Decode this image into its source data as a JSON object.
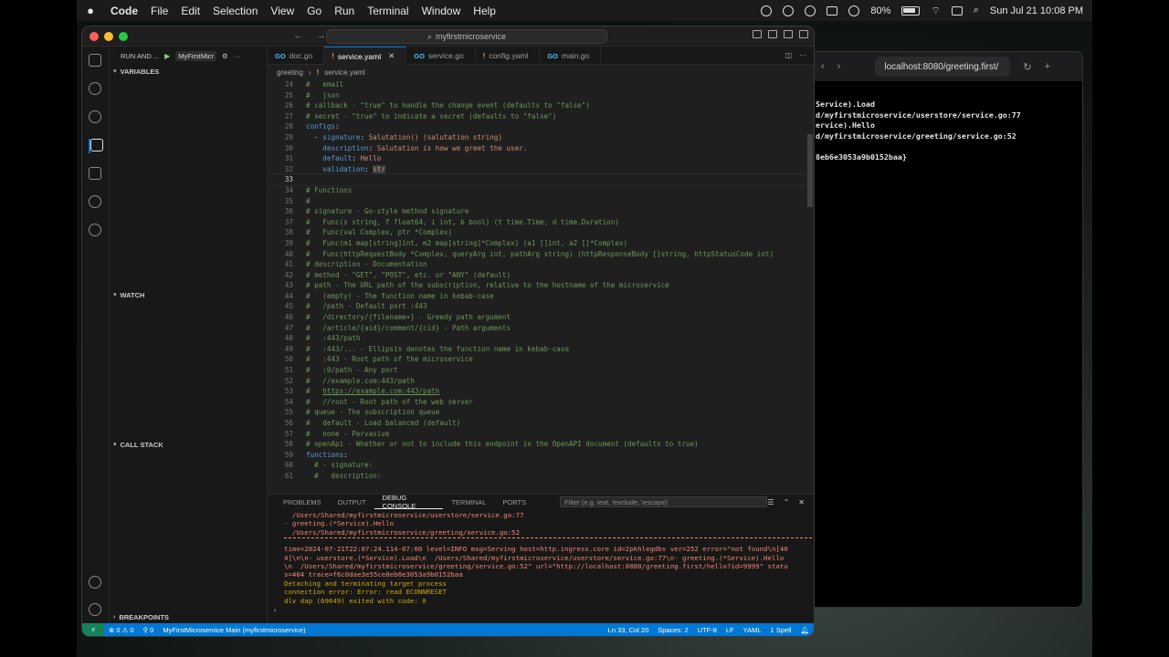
{
  "menubar": {
    "app": "Code",
    "items": [
      "File",
      "Edit",
      "Selection",
      "View",
      "Go",
      "Run",
      "Terminal",
      "Window",
      "Help"
    ],
    "battery": "80%",
    "clock": "Sun Jul 21  10:08 PM"
  },
  "window": {
    "search": "myfirstmicroservice"
  },
  "sidebar": {
    "run_label": "RUN AND ...",
    "config": "MyFirstMicr",
    "sections": {
      "variables": "VARIABLES",
      "watch": "WATCH",
      "callstack": "CALL STACK",
      "breakpoints": "BREAKPOINTS"
    }
  },
  "tabs": [
    {
      "label": "doc.go",
      "icon": "go"
    },
    {
      "label": "service.yaml",
      "icon": "yaml",
      "active": true
    },
    {
      "label": "service.go",
      "icon": "go"
    },
    {
      "label": "config.yaml",
      "icon": "yaml"
    },
    {
      "label": "main.go",
      "icon": "go"
    }
  ],
  "breadcrumb": {
    "folder": "greeting",
    "file": "service.yaml"
  },
  "code_lines": [
    {
      "n": "24",
      "t": "#   email",
      "cls": "c"
    },
    {
      "n": "25",
      "t": "#   json",
      "cls": "c"
    },
    {
      "n": "26",
      "t": "# callback - \"true\" to handle the change event (defaults to \"false\")",
      "cls": "c"
    },
    {
      "n": "27",
      "t": "# secret - \"true\" to indicate a secret (defaults to \"false\")",
      "cls": "c"
    },
    {
      "n": "28",
      "t": "configs:",
      "cls": "key"
    },
    {
      "n": "29",
      "t": "  - signature: Salutation() (salutation string)",
      "cls": "kv"
    },
    {
      "n": "30",
      "t": "    description: Salutation is how we greet the user.",
      "cls": "kv"
    },
    {
      "n": "31",
      "t": "    default: Hello",
      "cls": "kv"
    },
    {
      "n": "32",
      "t": "    validation: str",
      "cls": "kvsel"
    },
    {
      "n": "33",
      "t": "",
      "cls": ""
    },
    {
      "n": "34",
      "t": "# Functions",
      "cls": "c"
    },
    {
      "n": "35",
      "t": "#",
      "cls": "c"
    },
    {
      "n": "36",
      "t": "# signature - Go-style method signature",
      "cls": "c"
    },
    {
      "n": "37",
      "t": "#   Func(s string, f float64, i int, b bool) (t time.Time, d time.Duration)",
      "cls": "c"
    },
    {
      "n": "38",
      "t": "#   Func(val Complex, ptr *Complex)",
      "cls": "c"
    },
    {
      "n": "39",
      "t": "#   Func(m1 map[string]int, m2 map[string]*Complex) (a1 []int, a2 []*Complex)",
      "cls": "c"
    },
    {
      "n": "40",
      "t": "#   Func(httpRequestBody *Complex, queryArg int, pathArg string) (httpResponseBody []string, httpStatusCode int)",
      "cls": "c"
    },
    {
      "n": "41",
      "t": "# description - Documentation",
      "cls": "c"
    },
    {
      "n": "42",
      "t": "# method - \"GET\", \"POST\", etc. or \"ANY\" (default)",
      "cls": "c"
    },
    {
      "n": "43",
      "t": "# path - The URL path of the subscription, relative to the hostname of the microservice",
      "cls": "c"
    },
    {
      "n": "44",
      "t": "#   (empty) - The function name in kebab-case",
      "cls": "c"
    },
    {
      "n": "45",
      "t": "#   /path - Default port :443",
      "cls": "c"
    },
    {
      "n": "46",
      "t": "#   /directory/{filename+} - Greedy path argument",
      "cls": "c"
    },
    {
      "n": "47",
      "t": "#   /article/{aid}/comment/{cid} - Path arguments",
      "cls": "c"
    },
    {
      "n": "48",
      "t": "#   :443/path",
      "cls": "c"
    },
    {
      "n": "49",
      "t": "#   :443/... - Ellipsis denotes the function name in kebab-case",
      "cls": "c"
    },
    {
      "n": "50",
      "t": "#   :443 - Root path of the microservice",
      "cls": "c"
    },
    {
      "n": "51",
      "t": "#   :0/path - Any port",
      "cls": "c"
    },
    {
      "n": "52",
      "t": "#   //example.com:443/path",
      "cls": "c"
    },
    {
      "n": "53",
      "t": "#   https://example.com:443/path",
      "cls": "clink"
    },
    {
      "n": "54",
      "t": "#   //root - Root path of the web server",
      "cls": "c"
    },
    {
      "n": "55",
      "t": "# queue - The subscription queue",
      "cls": "c"
    },
    {
      "n": "56",
      "t": "#   default - Load balanced (default)",
      "cls": "c"
    },
    {
      "n": "57",
      "t": "#   none - Pervasive",
      "cls": "c"
    },
    {
      "n": "58",
      "t": "# openApi - Whether or not to include this endpoint in the OpenAPI document (defaults to true)",
      "cls": "c"
    },
    {
      "n": "59",
      "t": "functions:",
      "cls": "key"
    },
    {
      "n": "60",
      "t": "  # - signature:",
      "cls": "c"
    },
    {
      "n": "61",
      "t": "  #   description:",
      "cls": "c"
    }
  ],
  "panel": {
    "tabs": [
      "PROBLEMS",
      "OUTPUT",
      "DEBUG CONSOLE",
      "TERMINAL",
      "PORTS"
    ],
    "active_tab": "DEBUG CONSOLE",
    "filter_placeholder": "Filter (e.g. text, !exclude, \\escape)",
    "console": [
      {
        "t": "  /Users/Shared/myfirstmicroservice/userstore/service.go:77",
        "cls": "err"
      },
      {
        "t": "- greeting.(*Service).Hello",
        "cls": "err"
      },
      {
        "t": "  /Users/Shared/myfirstmicroservice/greeting/service.go:52",
        "cls": "err"
      },
      {
        "t": "",
        "cls": "sep"
      },
      {
        "t": "time=2024-07-21T22:07:24.114-07:00 level=INFO msg=Serving host=http.ingress.core id=2pkhlegdbs ver=252 error=\"not found\\n[40",
        "cls": "err"
      },
      {
        "t": "4]\\n\\n- userstore.(*Service).Load\\n  /Users/Shared/myfirstmicroservice/userstore/service.go:77\\n- greeting.(*Service).Hello",
        "cls": "err"
      },
      {
        "t": "\\n  /Users/Shared/myfirstmicroservice/greeting/service.go:52\" url=\"http://localhost:8080/greeting.first/hello?id=9999\" statu",
        "cls": "err"
      },
      {
        "t": "s=404 trace=f6c0dae3e55ce8eb6e3053a9b0152baa",
        "cls": "err"
      },
      {
        "t": "Detaching and terminating target process",
        "cls": "warn"
      },
      {
        "t": "connection error: Error: read ECONNRESET",
        "cls": "warn"
      },
      {
        "t": "dlv dap (69649) exited with code: 0",
        "cls": "warn"
      }
    ]
  },
  "statusbar": {
    "problems": "⊗ 0 ⚠ 0",
    "ports": "⚲ 0",
    "debug": "MyFirstMicroservice Main (myfirstmicroservice)",
    "position": "Ln 33, Col 20",
    "spaces": "Spaces: 2",
    "encoding": "UTF-8",
    "eol": "LF",
    "lang": "YAML",
    "spell": "1 Spell"
  },
  "browser": {
    "url": "localhost:8080/greeting.first/",
    "content": "Service).Load\nd/myfirstmicroservice/userstore/service.go:77\nervice).Hello\nd/myfirstmicroservice/greeting/service.go:52\n\n8eb6e3053a9b0152baa}"
  }
}
